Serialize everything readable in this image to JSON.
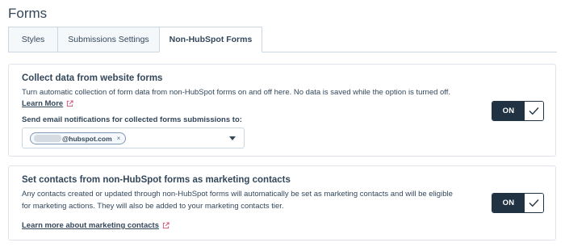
{
  "page": {
    "title": "Forms"
  },
  "tabs": [
    {
      "label": "Styles",
      "active": false
    },
    {
      "label": "Submissions Settings",
      "active": false
    },
    {
      "label": "Non-HubSpot Forms",
      "active": true
    }
  ],
  "collect_card": {
    "title": "Collect data from website forms",
    "description": "Turn automatic collection of form data from non-HubSpot forms on and off here. No data is saved while the option is turned off.",
    "learn_more_label": "Learn More",
    "notify_label": "Send email notifications for collected forms submissions to:",
    "email_chip": "@hubspot.com",
    "chip_remove": "×",
    "toggle_label": "ON"
  },
  "contacts_card": {
    "title": "Set contacts from non-HubSpot forms as marketing contacts",
    "description_line1": "Any contacts created or updated through non-HubSpot forms will automatically be set as marketing contacts and will be eligible",
    "description_line2": "for marketing actions. They will also be added to your marketing contacts tier.",
    "learn_more_label": "Learn more about marketing contacts",
    "toggle_label": "ON"
  },
  "colors": {
    "text": "#33475b",
    "toggle_dark": "#213343",
    "border": "#cbd6e2"
  }
}
